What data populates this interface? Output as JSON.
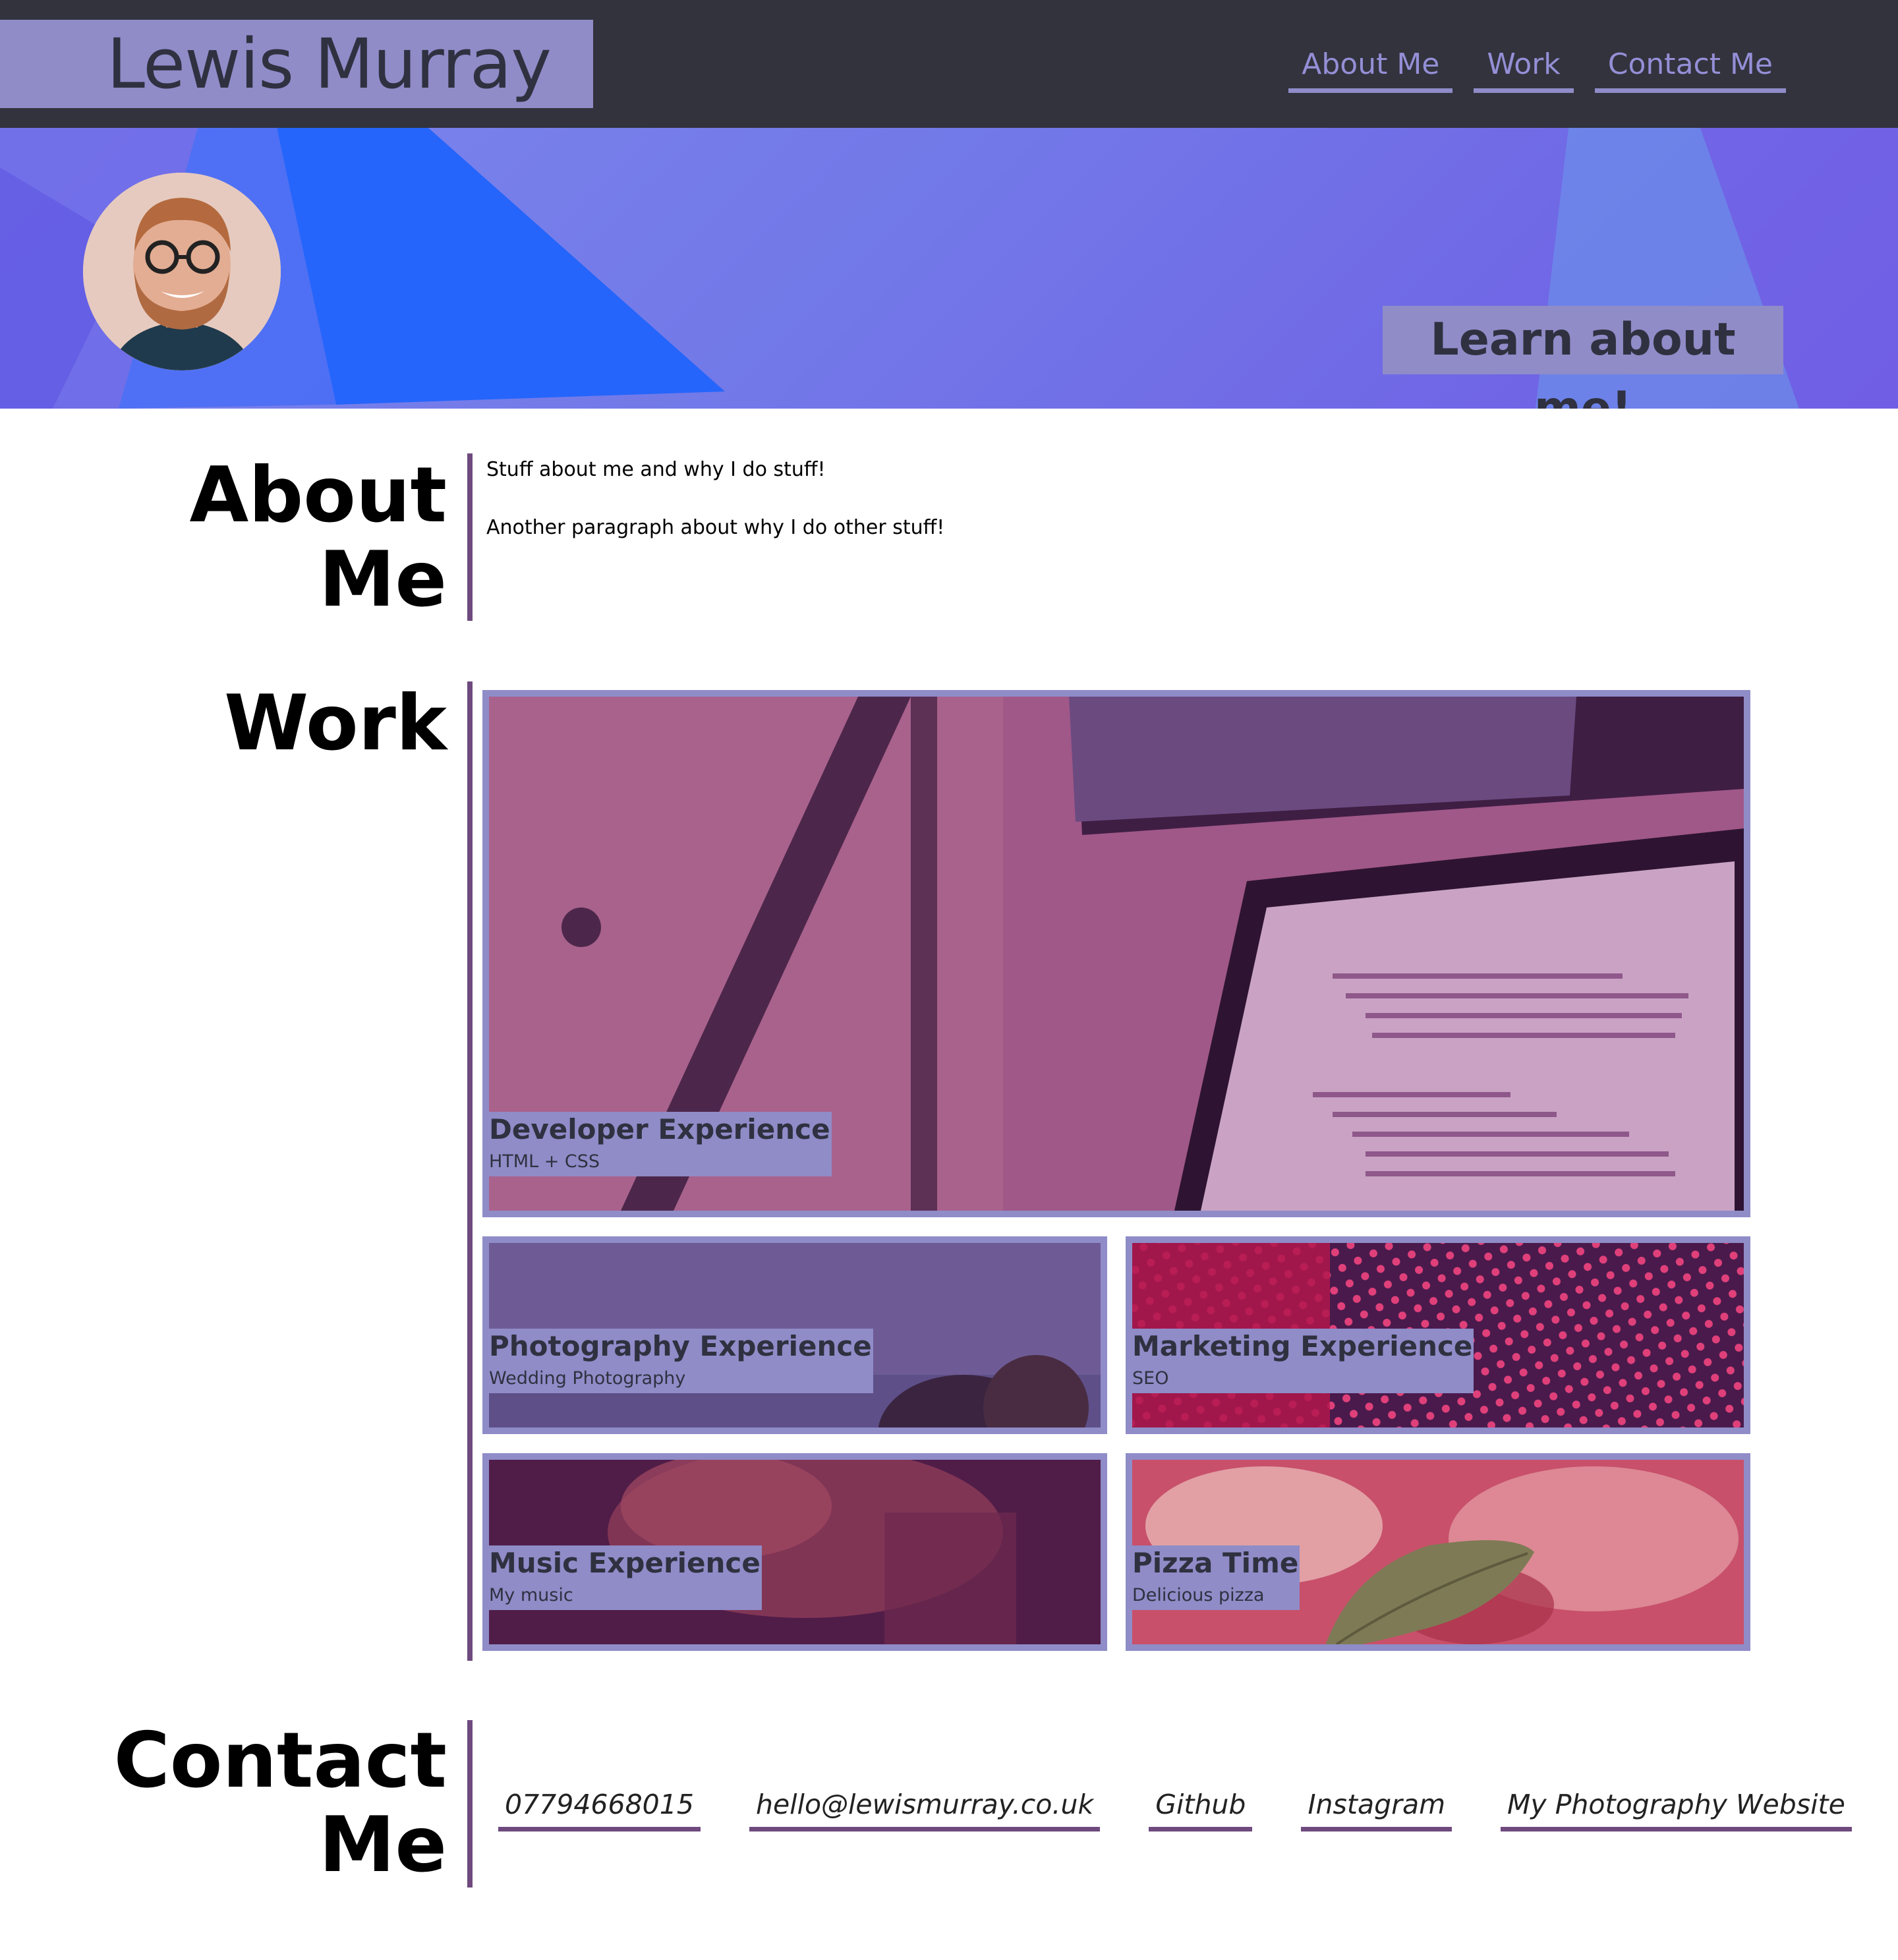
{
  "header": {
    "brand": "Lewis Murray",
    "nav": [
      "About Me",
      "Work",
      "Contact Me"
    ]
  },
  "hero": {
    "avatar_icon": "profile-photo",
    "cta": "Learn about me!"
  },
  "about": {
    "title_line1": "About",
    "title_line2": "Me",
    "paragraphs": [
      "Stuff about me and why I do stuff!",
      "Another paragraph about why I do other stuff!"
    ]
  },
  "work": {
    "title": "Work",
    "cards": [
      {
        "title": "Developer Experience",
        "subtitle": "HTML + CSS"
      },
      {
        "title": "Photography Experience",
        "subtitle": "Wedding Photography"
      },
      {
        "title": "Marketing Experience",
        "subtitle": "SEO"
      },
      {
        "title": "Music Experience",
        "subtitle": "My music"
      },
      {
        "title": "Pizza Time",
        "subtitle": "Delicious pizza"
      }
    ]
  },
  "contact": {
    "title_line1": "Contact",
    "title_line2": "Me",
    "links": [
      "07794668015",
      "hello@lewismurray.co.uk",
      "Github",
      "Instagram",
      "My Photography Website"
    ]
  },
  "colors": {
    "header_bg": "#32333d",
    "accent": "#8f8cc8",
    "rule": "#6e4a7e"
  }
}
